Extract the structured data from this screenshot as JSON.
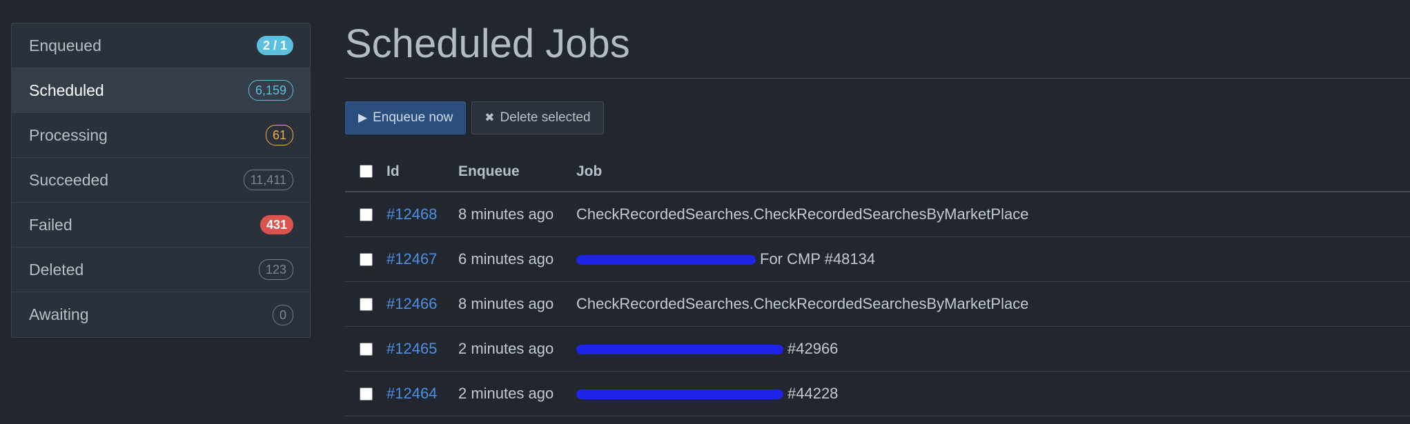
{
  "sidebar": {
    "items": [
      {
        "label": "Enqueued",
        "badge": "2 / 1"
      },
      {
        "label": "Scheduled",
        "badge": "6,159"
      },
      {
        "label": "Processing",
        "badge": "61"
      },
      {
        "label": "Succeeded",
        "badge": "11,411"
      },
      {
        "label": "Failed",
        "badge": "431"
      },
      {
        "label": "Deleted",
        "badge": "123"
      },
      {
        "label": "Awaiting",
        "badge": "0"
      }
    ]
  },
  "page": {
    "title": "Scheduled Jobs"
  },
  "toolbar": {
    "enqueue_label": "Enqueue now",
    "delete_label": "Delete selected"
  },
  "table": {
    "headers": {
      "id": "Id",
      "enqueue": "Enqueue",
      "job": "Job"
    },
    "rows": [
      {
        "id": "#12468",
        "enqueue": "8 minutes ago",
        "job": "CheckRecordedSearches.CheckRecordedSearchesByMarketPlace"
      },
      {
        "id": "#12467",
        "enqueue": "6 minutes ago",
        "job": "For CMP #48134"
      },
      {
        "id": "#12466",
        "enqueue": "8 minutes ago",
        "job": "CheckRecordedSearches.CheckRecordedSearchesByMarketPlace"
      },
      {
        "id": "#12465",
        "enqueue": "2 minutes ago",
        "job": "#42966"
      },
      {
        "id": "#12464",
        "enqueue": "2 minutes ago",
        "job": "#44228"
      }
    ]
  },
  "colors": {
    "background": "#22272f",
    "link": "#4d8fe0",
    "badge_info": "#5bc0de",
    "badge_warning": "#f0ad4e",
    "badge_danger": "#d9534f",
    "primary_button": "#2a4f7c"
  },
  "icons": {
    "enqueue": "play-icon",
    "delete": "close-icon"
  }
}
